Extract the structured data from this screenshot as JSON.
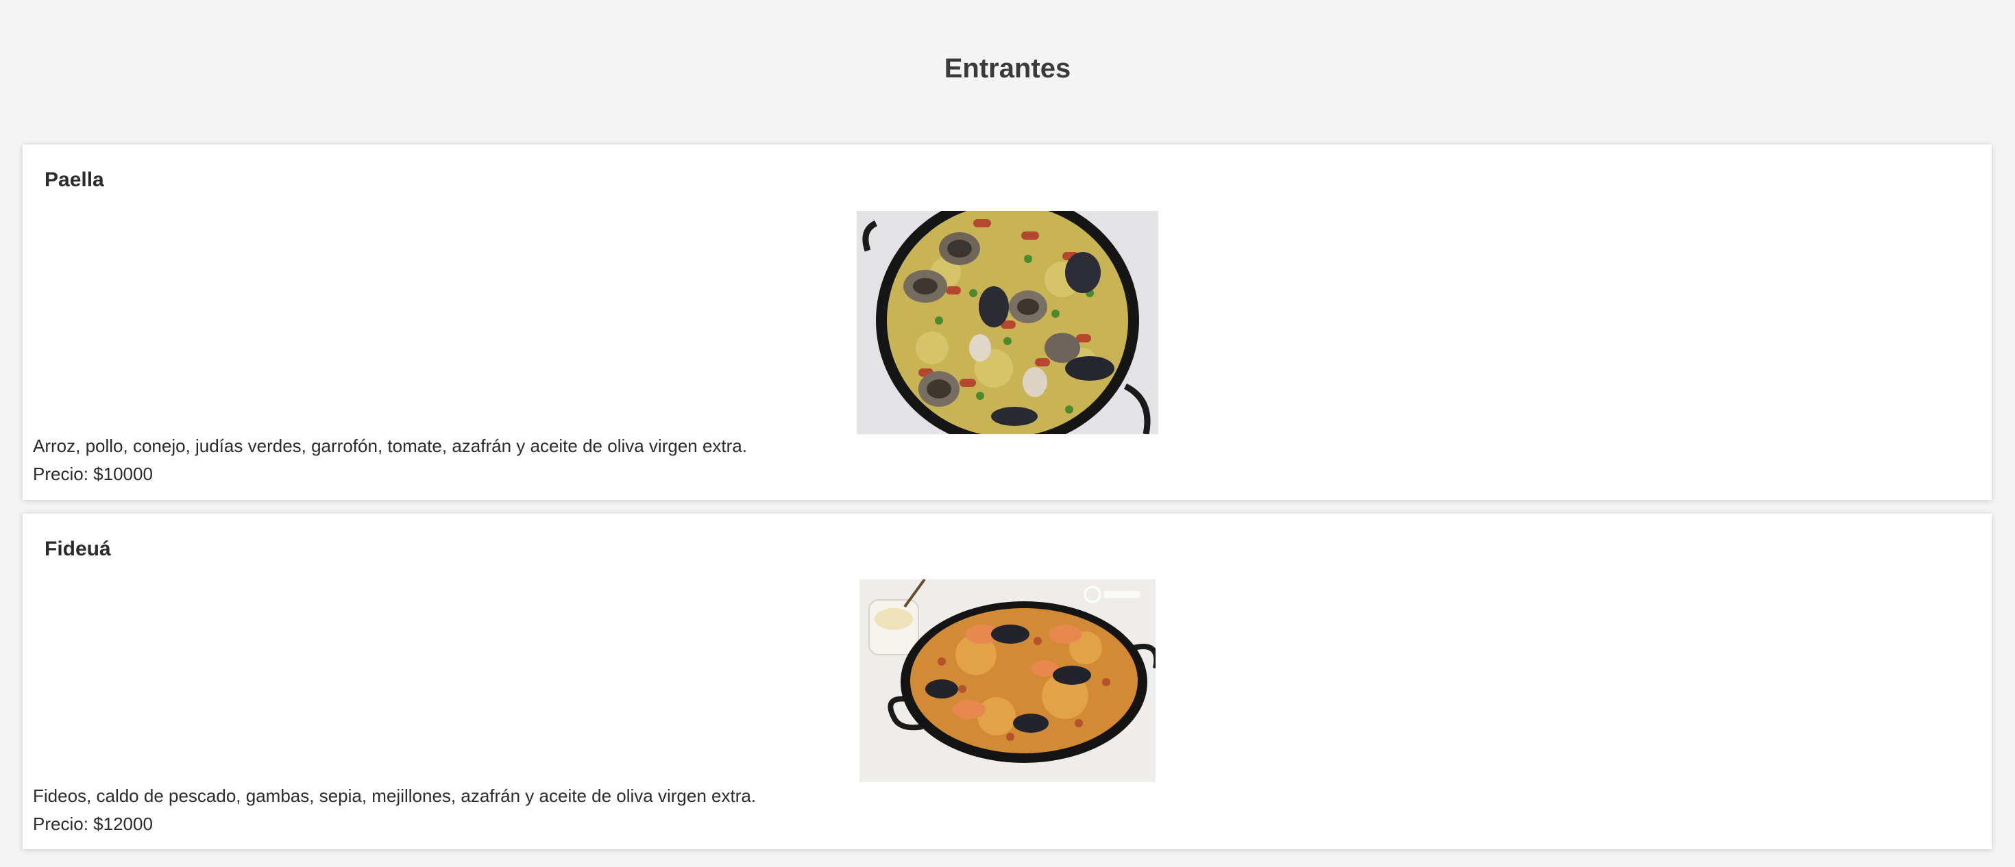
{
  "page": {
    "title": "Entrantes"
  },
  "dishes": [
    {
      "name": "Paella",
      "description": "Arroz, pollo, conejo, judías verdes, garrofón, tomate, azafrán y aceite de oliva virgen extra.",
      "price": "Precio: $10000",
      "photo_icon": "paella-photo"
    },
    {
      "name": "Fideuá",
      "description": "Fideos, caldo de pescado, gambas, sepia, mejillones, azafrán y aceite de oliva virgen extra.",
      "price": "Precio: $12000",
      "photo_icon": "fideua-photo"
    }
  ]
}
